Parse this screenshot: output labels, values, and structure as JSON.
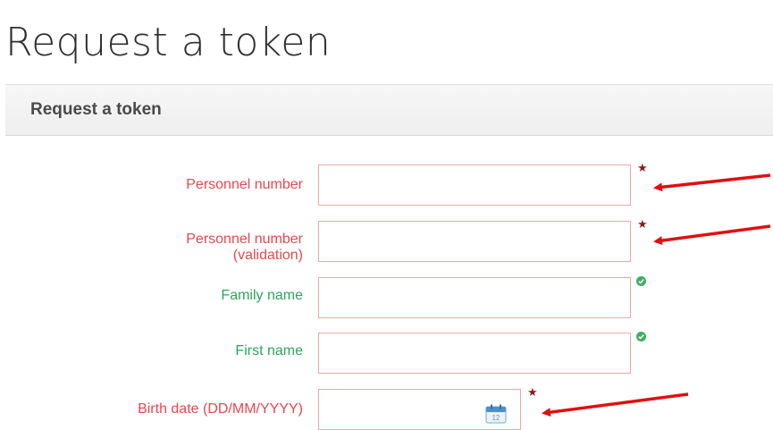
{
  "page": {
    "title": "Request a token"
  },
  "panel": {
    "title": "Request a token"
  },
  "form": {
    "personnel_number": {
      "label": "Personnel number",
      "value": ""
    },
    "personnel_number_validation": {
      "label_line1": "Personnel number",
      "label_line2": "(validation)",
      "value": ""
    },
    "family_name": {
      "label": "Family name",
      "value": ""
    },
    "first_name": {
      "label": "First name",
      "value": ""
    },
    "birth_date": {
      "label": "Birth date (DD/MM/YYYY)",
      "value": "",
      "calendar_day": "12"
    },
    "required_marker": "★"
  },
  "colors": {
    "error_label": "#e8474f",
    "valid_label": "#2aa65b",
    "input_border": "#f0a6a8",
    "annotation_arrow": "#e01010"
  },
  "icons": [
    "required-star-icon",
    "check-circle-icon",
    "calendar-icon",
    "annotation-arrow"
  ]
}
